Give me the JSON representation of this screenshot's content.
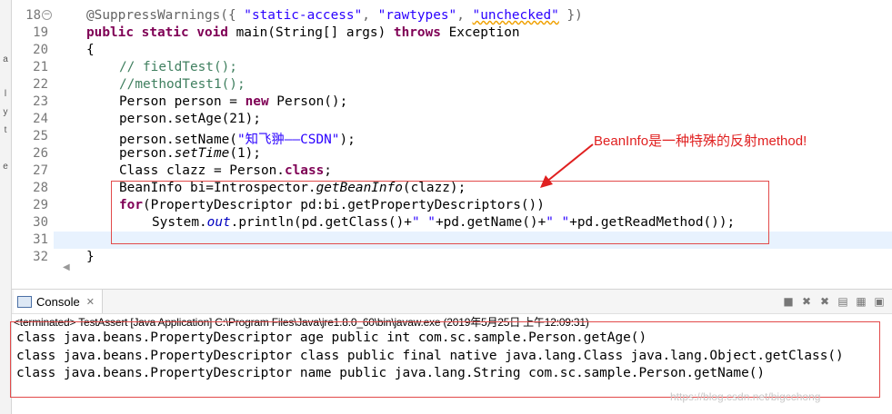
{
  "editor": {
    "lines": [
      {
        "num": "18"
      },
      {
        "num": "19"
      },
      {
        "num": "20"
      },
      {
        "num": "21"
      },
      {
        "num": "22"
      },
      {
        "num": "23"
      },
      {
        "num": "24"
      },
      {
        "num": "25"
      },
      {
        "num": "26"
      },
      {
        "num": "27"
      },
      {
        "num": "28"
      },
      {
        "num": "29"
      },
      {
        "num": "30"
      },
      {
        "num": "31"
      },
      {
        "num": "32"
      }
    ],
    "code": {
      "l18": {
        "ann": "@SuppressWarnings({ ",
        "s1": "\"static-access\"",
        "c1": ", ",
        "s2": "\"rawtypes\"",
        "c2": ", ",
        "s3": "\"unchecked\"",
        "end": " })"
      },
      "l19": {
        "kw1": "public",
        "kw2": "static",
        "kw3": "void",
        "rest": " main(String[] args) ",
        "kw4": "throws",
        "rest2": " Exception"
      },
      "l20": "{",
      "l21": "// fieldTest();",
      "l22": "//methodTest1();",
      "l23": {
        "a": "Person person = ",
        "kw": "new",
        "b": " Person();"
      },
      "l24": {
        "a": "person.setAge(21);"
      },
      "l25": {
        "a": "person.setName(",
        "s": "\"知飞翀——CSDN\"",
        "b": ");"
      },
      "l26": {
        "a": "person.",
        "i": "setTime",
        "b": "(1);"
      },
      "l27": {
        "a": "Class clazz = Person.",
        "kw": "class",
        "b": ";"
      },
      "l28": {
        "a": "BeanInfo bi=Introspector.",
        "i": "getBeanInfo",
        "b": "(clazz);"
      },
      "l29": {
        "kw": "for",
        "a": "(PropertyDescriptor pd:bi.getPropertyDescriptors())"
      },
      "l30": {
        "a": "System.",
        "f": "out",
        "b": ".println(pd.getClass()+",
        "s1": "\" \"",
        "c": "+pd.getName()+",
        "s2": "\" \"",
        "d": "+pd.getReadMethod());"
      },
      "l32": "}"
    }
  },
  "annotation": {
    "text": "BeanInfo是一种特殊的反射method!"
  },
  "console": {
    "tab_label": "Console",
    "terminated": "<terminated> TestAssert [Java Application] C:\\Program Files\\Java\\jre1.8.0_60\\bin\\javaw.exe (2019年5月25日 上午12:09:31)",
    "output": [
      "class java.beans.PropertyDescriptor age public int com.sc.sample.Person.getAge()",
      "class java.beans.PropertyDescriptor class public final native java.lang.Class java.lang.Object.getClass()",
      "class java.beans.PropertyDescriptor name public java.lang.String com.sc.sample.Person.getName()"
    ],
    "watermark": "https://blog.csdn.net/bigcchong"
  },
  "colors": {
    "keyword": "#7f0055",
    "string": "#2a00ff",
    "comment": "#3f7f5f",
    "field": "#0000c0",
    "annotation_red": "#e24a4a",
    "current_line": "#e8f2fe"
  },
  "icons": [
    "console-icon",
    "close-icon",
    "terminate-icon",
    "remove-launch-icon",
    "remove-all-icon",
    "scroll-lock-icon",
    "pin-icon"
  ]
}
